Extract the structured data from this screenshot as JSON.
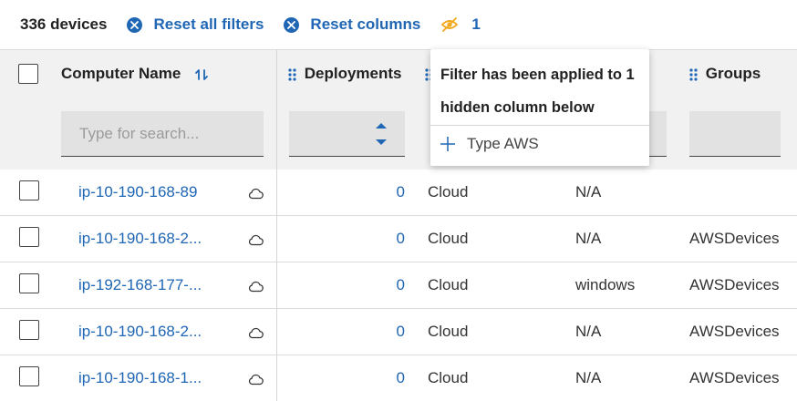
{
  "toolbar": {
    "device_count": "336 devices",
    "reset_filters_label": "Reset all filters",
    "reset_columns_label": "Reset columns",
    "hidden_filter_count": "1",
    "colors": {
      "accent": "#1f66b5",
      "warning": "#f2a81d"
    }
  },
  "columns": {
    "computer_name": "Computer Name",
    "deployments": "Deployments",
    "groups": "Groups",
    "search_placeholder": "Type for search..."
  },
  "popover": {
    "message": "Filter has been applied to 1 hidden column below",
    "item_label": "Type AWS"
  },
  "rows": [
    {
      "name": "ip-10-190-168-89",
      "deployments": "0",
      "type": "Cloud",
      "os": "N/A",
      "group": ""
    },
    {
      "name": "ip-10-190-168-2...",
      "deployments": "0",
      "type": "Cloud",
      "os": "N/A",
      "group": "AWSDevices"
    },
    {
      "name": "ip-192-168-177-...",
      "deployments": "0",
      "type": "Cloud",
      "os": "windows",
      "group": "AWSDevices"
    },
    {
      "name": "ip-10-190-168-2...",
      "deployments": "0",
      "type": "Cloud",
      "os": "N/A",
      "group": "AWSDevices"
    },
    {
      "name": "ip-10-190-168-1...",
      "deployments": "0",
      "type": "Cloud",
      "os": "N/A",
      "group": "AWSDevices"
    }
  ]
}
